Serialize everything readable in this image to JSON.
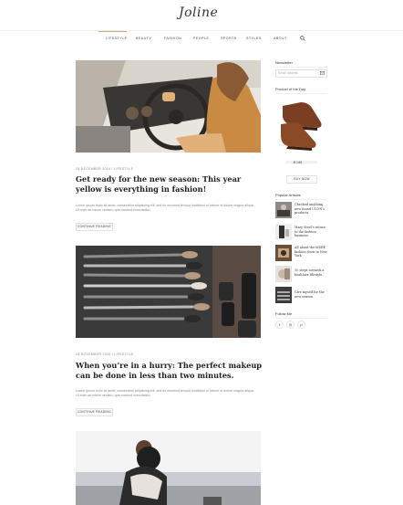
{
  "site": {
    "logo": "Joline"
  },
  "nav": [
    {
      "label": "Lifestyle",
      "active": true
    },
    {
      "label": "Beauty"
    },
    {
      "label": "Fashion"
    },
    {
      "label": "People"
    },
    {
      "label": "Sports"
    },
    {
      "label": "Styles"
    },
    {
      "label": "About"
    }
  ],
  "posts": [
    {
      "meta": "15 December 2019 / Lifestyle",
      "title": "Get ready for the new season: This year yellow is everything in fashion!",
      "excerpt": "Lorem ipsum dolor sit amet, consectetur adipiscing elit, sed do eiusmod tempor incididunt ut labore et dolore magna aliqua. Ut enim ad minim veniam, quis nostrud exercitation.",
      "button": "Continue reading"
    },
    {
      "meta": "15 November 2019 / Lifestyle",
      "title": "When you’re in a hurry: The perfect makeup can be done in less than two minutes.",
      "excerpt": "Lorem ipsum dolor sit amet, consectetur adipiscing elit, sed do eiusmod tempor incididunt ut labore et dolore magna aliqua. Ut enim ad minim veniam, quis nostrud exercitation.",
      "button": "Continue reading"
    }
  ],
  "sidebar": {
    "newsletter": {
      "title": "Newsletter",
      "placeholder": "Email address"
    },
    "product": {
      "title": "Product of the Day",
      "price": "$ 149",
      "button": "Buy now"
    },
    "popular": {
      "title": "Popular Articles",
      "items": [
        {
          "title": "Checked anything new found UCON’s products"
        },
        {
          "title": "Mary Steel’s return to the fashion business"
        },
        {
          "title": "All about the MSRE fashion show in New York"
        },
        {
          "title": "10 steps towards a healthier lifestyle"
        },
        {
          "title": "Give myself for the new season"
        }
      ]
    },
    "follow": {
      "title": "Follow Me",
      "icons": [
        "facebook-icon",
        "instagram-icon",
        "pinterest-icon"
      ]
    }
  },
  "colors": {
    "accent": "#c9a97a",
    "text": "#222222",
    "muted": "#888888"
  }
}
